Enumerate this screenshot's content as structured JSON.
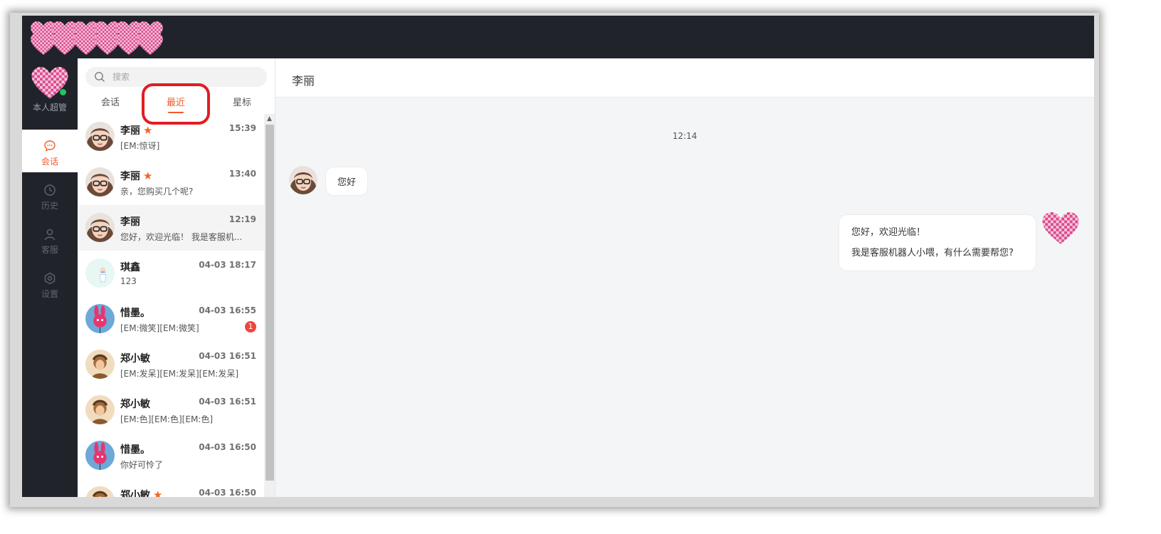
{
  "colors": {
    "accent": "#f05a28",
    "star": "#f26522",
    "online": "#22c55e",
    "badge": "#f0463c",
    "dark_bg": "#20232a",
    "highlight": "#e11d23"
  },
  "topbar": {
    "logo_icon": "checkered-hearts-logo"
  },
  "user": {
    "name": "本人超管",
    "avatar_icon": "checkered-heart-avatar",
    "status": "online"
  },
  "nav": [
    {
      "label": "会话",
      "icon": "chat-bubble-icon",
      "active": true
    },
    {
      "label": "历史",
      "icon": "clock-icon",
      "active": false
    },
    {
      "label": "客服",
      "icon": "user-icon",
      "active": false
    },
    {
      "label": "设置",
      "icon": "gear-icon",
      "active": false
    }
  ],
  "search": {
    "placeholder": "搜索",
    "value": ""
  },
  "tabs": [
    {
      "label": "会话",
      "active": false
    },
    {
      "label": "最近",
      "active": true
    },
    {
      "label": "星标",
      "active": false
    }
  ],
  "conversations": [
    {
      "name": "李丽",
      "starred": true,
      "time": "15:39",
      "preview": "[EM:惊讶]",
      "avatar": "cartoon-glasses-face",
      "badge": ""
    },
    {
      "name": "李丽",
      "starred": true,
      "time": "13:40",
      "preview": "亲，您购买几个呢?",
      "avatar": "cartoon-glasses-face",
      "badge": ""
    },
    {
      "name": "李丽",
      "starred": false,
      "time": "12:19",
      "preview": "您好，欢迎光临！ 我是客服机...",
      "avatar": "cartoon-glasses-face",
      "badge": "",
      "selected": true
    },
    {
      "name": "琪鑫",
      "starred": false,
      "time": "04-03 18:17",
      "preview": "123",
      "avatar": "pastel-figure",
      "badge": ""
    },
    {
      "name": "惜墨。",
      "starred": false,
      "time": "04-03 16:55",
      "preview": "[EM:微笑][EM:微笑]",
      "avatar": "pink-bunny-balloon",
      "badge": "1"
    },
    {
      "name": "郑小敏",
      "starred": false,
      "time": "04-03 16:51",
      "preview": "[EM:发呆][EM:发呆][EM:发呆]",
      "avatar": "warrior-girl",
      "badge": ""
    },
    {
      "name": "郑小敏",
      "starred": false,
      "time": "04-03 16:51",
      "preview": "[EM:色][EM:色][EM:色]",
      "avatar": "warrior-girl",
      "badge": ""
    },
    {
      "name": "惜墨。",
      "starred": false,
      "time": "04-03 16:50",
      "preview": "你好可怜了",
      "avatar": "pink-bunny-balloon",
      "badge": ""
    },
    {
      "name": "郑小敏",
      "starred": true,
      "time": "04-03 16:50",
      "preview": "",
      "avatar": "warrior-girl",
      "badge": ""
    }
  ],
  "chat": {
    "title": "李丽",
    "timestamp": "12:14",
    "messages": [
      {
        "direction": "in",
        "avatar": "cartoon-glasses-face",
        "lines": [
          "您好"
        ]
      },
      {
        "direction": "out",
        "avatar": "checkered-heart-avatar",
        "lines": [
          "您好，欢迎光临！",
          "我是客服机器人小喂，有什么需要帮您?"
        ]
      }
    ]
  }
}
